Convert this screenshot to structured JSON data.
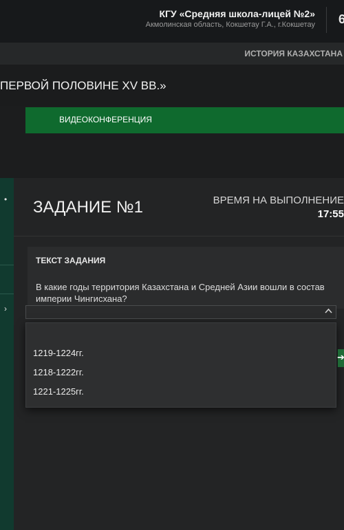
{
  "header": {
    "school_name": "КГУ «Средняя школа-лицей №2»",
    "school_address": "Акмолинская область, Кокшетау Г.А., г.Кокшетау",
    "number_fragment": "6"
  },
  "subject": "ИСТОРИЯ КАЗАХСТАНА",
  "lesson_title": "ПЕРВОЙ ПОЛОВИНЕ XV ВВ.»",
  "videoconference_label": "ВИДЕОКОНФЕРЕНЦИЯ",
  "task": {
    "title": "ЗАДАНИЕ №1",
    "time_label": "ВРЕМЯ НА ВЫПОЛНЕНИЕ",
    "timer": "17:55",
    "text_label": "ТЕКСТ ЗАДАНИЯ",
    "question": "В какие годы территория Казахстана и Средней Азии вошли в состав империи Чингисхана?"
  },
  "answer_select": {
    "options": [
      "1219-1224гг.",
      "1218-1222гг.",
      "1221-1225гг."
    ]
  },
  "icons": {
    "dropdown_chevron": "chevron-up-icon",
    "next_arrow": "arrow-right-icon"
  },
  "colors": {
    "accent_green": "#0f6a2e",
    "sidebar": "#113a2f",
    "background": "#1c1d1e"
  }
}
